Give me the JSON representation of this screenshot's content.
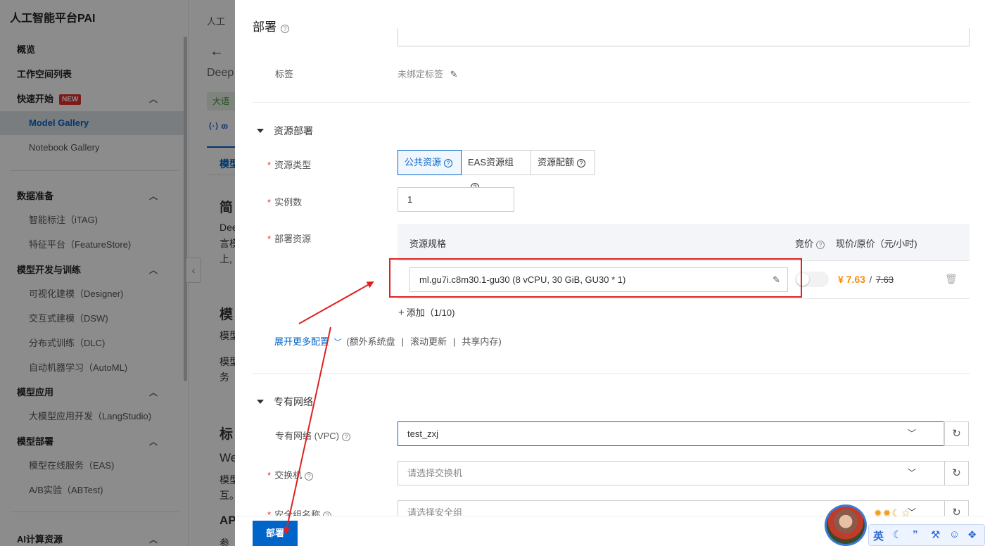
{
  "sidebar": {
    "title": "人工智能平台PAI",
    "items": [
      {
        "label": "概览"
      },
      {
        "label": "工作空间列表"
      },
      {
        "label": "快速开始",
        "badge": "NEW"
      },
      {
        "label": "Model Gallery"
      },
      {
        "label": "Notebook Gallery"
      },
      {
        "label": "数据准备"
      },
      {
        "label": "智能标注（iTAG)"
      },
      {
        "label": "特征平台（FeatureStore)"
      },
      {
        "label": "模型开发与训练"
      },
      {
        "label": "可视化建模（Designer)"
      },
      {
        "label": "交互式建模（DSW)"
      },
      {
        "label": "分布式训练（DLC)"
      },
      {
        "label": "自动机器学习（AutoML)"
      },
      {
        "label": "模型应用"
      },
      {
        "label": "大模型应用开发（LangStudio)"
      },
      {
        "label": "模型部署"
      },
      {
        "label": "模型在线服务（EAS)"
      },
      {
        "label": "A/B实验（ABTest)"
      },
      {
        "label": "AI计算资源"
      }
    ]
  },
  "middle": {
    "breadcrumb": "人工",
    "title_partial": "Deep",
    "tag_partial": "大语",
    "tab_partial": "模型",
    "h_intro": "简",
    "p1": "Dee",
    "p2": "言模",
    "p3": "上,",
    "h_model": "模",
    "p4": "模型",
    "p5": "模型",
    "p6": "务",
    "h_std": "标",
    "p7": "We",
    "p8": "模型",
    "p9": "互。",
    "h_api": "AP",
    "p10": "参"
  },
  "drawer": {
    "title": "部署",
    "tag_label": "标签",
    "tag_value": "未绑定标签",
    "section_resource": "资源部署",
    "resource_type_label": "资源类型",
    "resource_types": [
      "公共资源",
      "EAS资源组",
      "资源配额"
    ],
    "instance_label": "实例数",
    "instance_value": "1",
    "deploy_resource_label": "部署资源",
    "table": {
      "col_spec": "资源规格",
      "col_bid": "竞价",
      "col_price": "现价/原价（元/小时)",
      "spec_value": "ml.gu7i.c8m30.1-gu30  (8 vCPU, 30 GiB, GU30 * 1)",
      "price_now": "¥ 7.63",
      "price_sep": "/",
      "price_old": "7.63"
    },
    "add_label": "添加（1/10)",
    "expand_link": "展开更多配置",
    "expand_extra": [
      "(额外系统盘",
      "滚动更新",
      "共享内存)"
    ],
    "section_network": "专有网络",
    "vpc_label": "专有网络 (VPC)",
    "vpc_value": "test_zxj",
    "switch_label": "交换机",
    "switch_placeholder": "请选择交换机",
    "sg_label": "安全组名称",
    "sg_placeholder": "请选择安全组",
    "deploy_button": "部署"
  },
  "ime": {
    "keys": [
      "英",
      "☾",
      "”",
      "⚒",
      "☺",
      "❖"
    ],
    "stars": "✹✹☾☆"
  },
  "colors": {
    "primary": "#0064c8",
    "price": "#ff8a00",
    "required": "#e62e2e",
    "annotation": "#e02020"
  }
}
